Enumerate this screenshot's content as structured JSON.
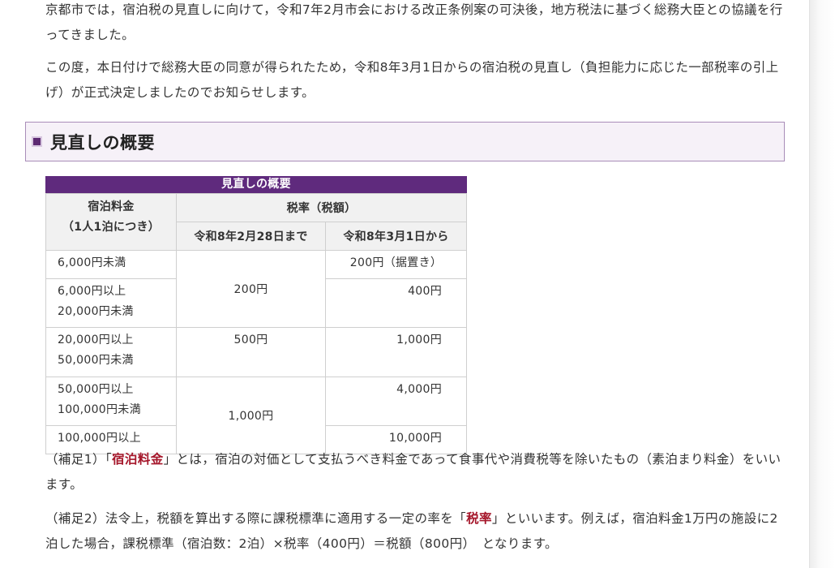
{
  "paragraphs": {
    "p1": "京都市では，宿泊税の見直しに向けて，令和7年2月市会における改正条例案の可決後，地方税法に基づく総務大臣との協議を行ってきました。",
    "p2": "この度，本日付けで総務大臣の同意が得られたため，令和8年3月1日からの宿泊税の見直し（負担能力に応じた一部税率の引上げ）が正式決定しましたのでお知らせします。"
  },
  "section": {
    "title": "見直しの概要"
  },
  "table": {
    "caption": "見直しの概要",
    "header": {
      "fee_line1": "宿泊料金",
      "fee_line2": "（1人1泊につき）",
      "rate": "税率（税額）",
      "col_old": "令和8年2月28日まで",
      "col_new": "令和8年3月1日から"
    },
    "rows": [
      {
        "fee": "6,000円未満",
        "new": "200円（据置き）"
      },
      {
        "fee_line1": "6,000円以上",
        "fee_line2": "20,000円未満",
        "new": "400円"
      },
      {
        "fee_line1": "20,000円以上",
        "fee_line2": "50,000円未満",
        "new": "1,000円"
      },
      {
        "fee_line1": "50,000円以上",
        "fee_line2": "100,000円未満",
        "new": "4,000円"
      },
      {
        "fee": "100,000円以上",
        "new": "10,000円"
      }
    ],
    "old_rates": {
      "tier1": "200円",
      "tier2": "500円",
      "tier3": "1,000円"
    }
  },
  "notes": {
    "note1_prefix": "（補足1）「",
    "note1_keyword": "宿泊料金",
    "note1_suffix": "」とは，宿泊の対価として支払うべき料金であって食事代や消費税等を除いたもの（素泊まり料金）をいいます。",
    "note2_prefix": "（補足2）法令上，税額を算出する際に課税標準に適用する一定の率を「",
    "note2_keyword": "税率",
    "note2_suffix": "」といいます。例えば，宿泊料金1万円の施設に2泊した場合，課税標準（宿泊数：2泊）×税率（400円）＝税額（800円）　となります。"
  },
  "colors": {
    "caption_bg": "#5f2a7d",
    "heading_bg": "#f6f1f8",
    "heading_border": "#a98db8",
    "highlight": "#a5162a"
  }
}
